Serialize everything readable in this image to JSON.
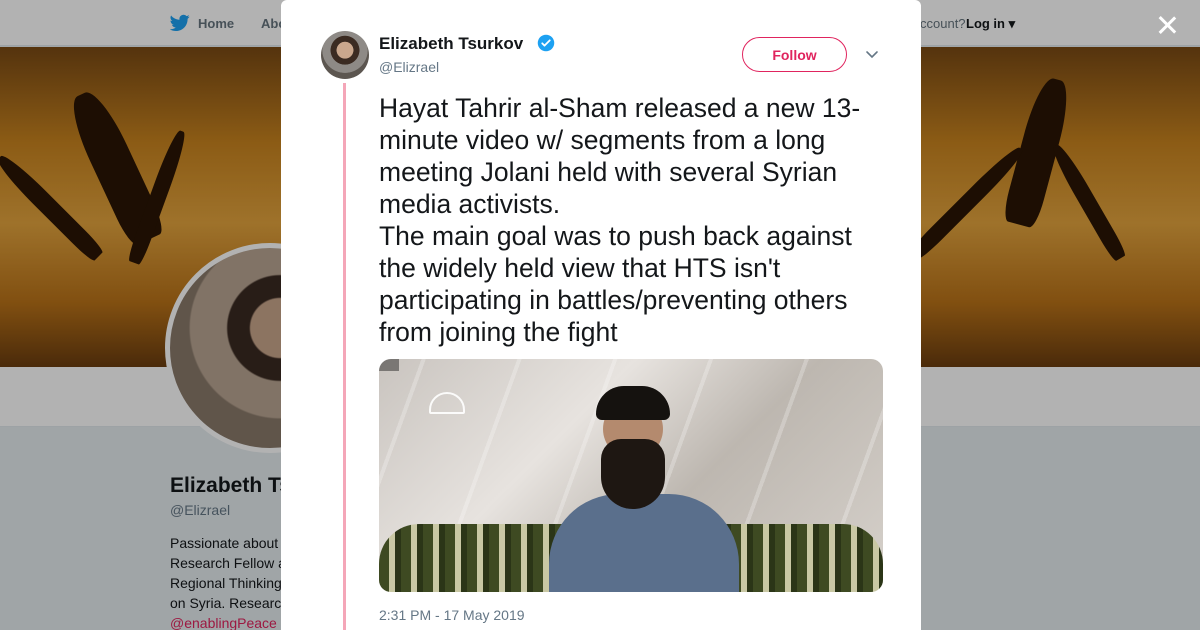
{
  "nav": {
    "home_label": "Home",
    "about_label": "Abo",
    "account_text": "ccount?",
    "login_label": "Log in"
  },
  "profile": {
    "name": "Elizabeth Ts",
    "handle": "@Elizrael",
    "bio_lines": [
      "Passionate about",
      "Research Fellow a",
      "Regional Thinking",
      "on Syria. Researc"
    ],
    "bio_link": "@enablingPeace"
  },
  "tweet": {
    "author_name": "Elizabeth Tsurkov",
    "author_handle": "@Elizrael",
    "follow_label": "Follow",
    "text": "Hayat Tahrir al-Sham released a new 13-minute video w/ segments from a long meeting Jolani held with several Syrian media activists.\nThe main goal was to push back against the widely held view that HTS isn't participating in battles/preventing others from joining the fight",
    "timestamp": "2:31 PM - 17 May 2019"
  },
  "colors": {
    "accent": "#e0245e",
    "verified": "#1da1f2",
    "thread_line": "#f4a6b8"
  },
  "icons": {
    "nav_logo": "twitter-bird-icon",
    "verified": "verified-badge-icon",
    "caret": "chevron-down-icon",
    "close": "close-icon"
  }
}
